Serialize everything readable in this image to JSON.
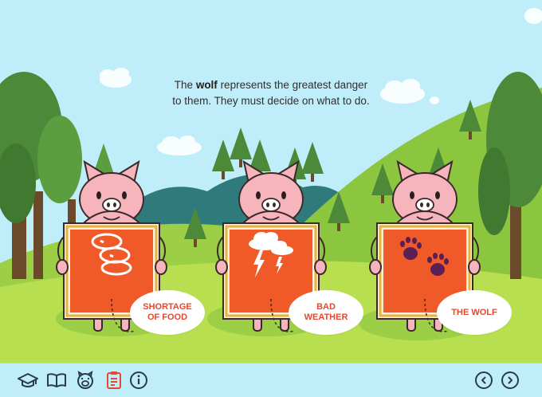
{
  "caption": {
    "before": "The ",
    "bold": "wolf",
    "line1_after": " represents the greatest danger",
    "line2": "to them. They must decide on what to do."
  },
  "cards": [
    {
      "label_line1": "SHORTAGE",
      "label_line2": "OF FOOD",
      "icon": "cookies-icon"
    },
    {
      "label_line1": "BAD",
      "label_line2": "WEATHER",
      "icon": "storm-cloud-icon"
    },
    {
      "label_line1": "THE WOLF",
      "label_line2": "",
      "icon": "paw-prints-icon"
    }
  ],
  "toolbar": {
    "left_icons": [
      "graduation-cap-icon",
      "book-icon",
      "pig-icon",
      "clipboard-icon",
      "info-icon"
    ],
    "right_icons": [
      "chevron-left-icon",
      "chevron-right-icon"
    ]
  },
  "colors": {
    "sky": "#bfeefa",
    "hill_green": "#8cc63f",
    "pig_pink": "#f6b4bd",
    "card_orange": "#f05a28",
    "accent_red": "#e8462e",
    "toolbar_icon": "#2b3a4c"
  }
}
